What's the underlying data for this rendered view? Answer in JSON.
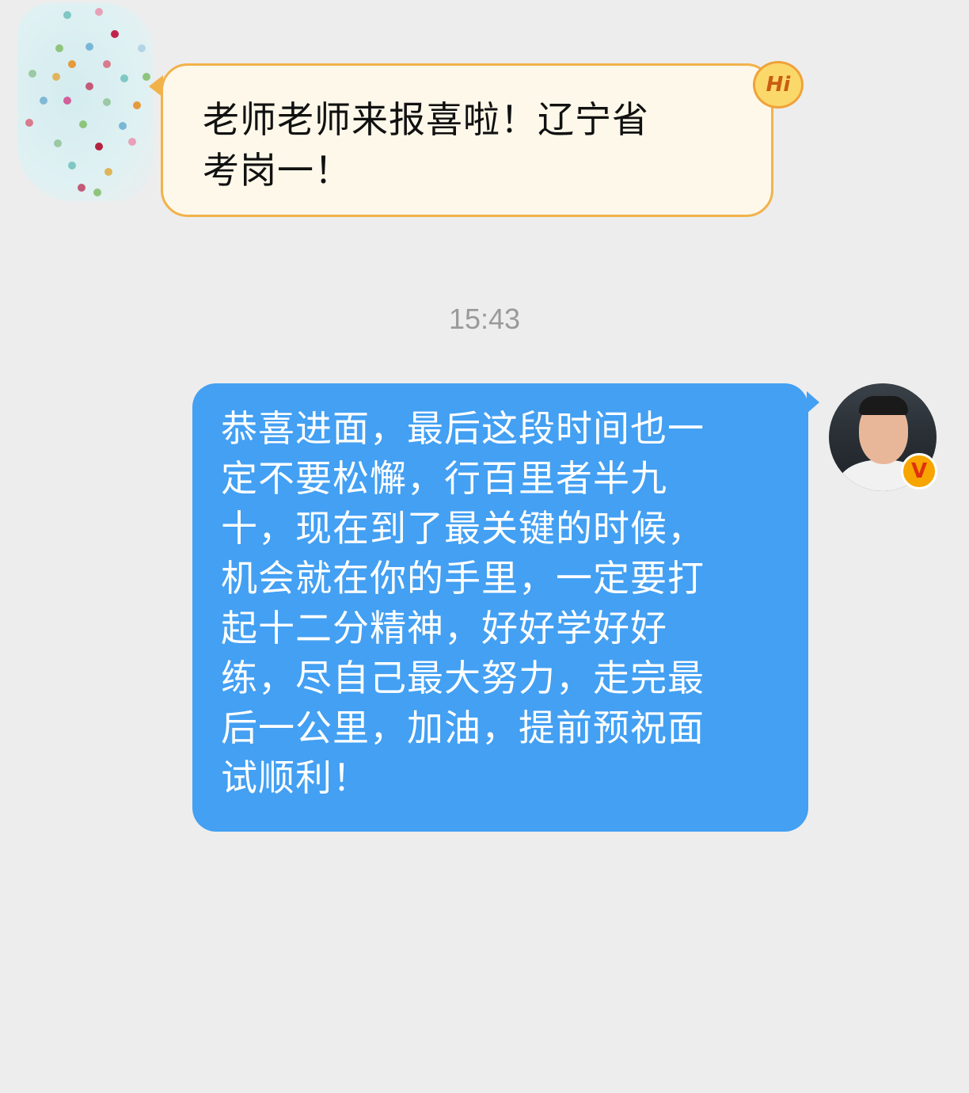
{
  "messages": {
    "incoming": {
      "lines": [
        "老师老师来报喜啦！辽宁省",
        "考岗一！"
      ],
      "badge_label": "Hi"
    },
    "timestamp": "15:43",
    "outgoing": {
      "lines": [
        "恭喜进面，最后这段时间也一",
        "定不要松懈，行百里者半九",
        "十，现在到了最关键的时候，",
        "机会就在你的手里，一定要打",
        "起十二分精神，好好学好好",
        "练，尽自己最大努力，走完最",
        "后一公里，加油，提前预祝面",
        "试顺利！"
      ],
      "verified_label": "V"
    }
  },
  "colors": {
    "incoming_bubble_fill": "#fdf8ea",
    "incoming_bubble_border": "#f2b24a",
    "outgoing_bubble_fill": "#43a0f3",
    "background": "#ededed"
  },
  "icons": {
    "incoming_avatar": "polka-dot-avatar",
    "hi_badge": "hi-badge-icon",
    "outgoing_avatar": "user-photo-avatar",
    "verified": "verified-v-icon"
  }
}
